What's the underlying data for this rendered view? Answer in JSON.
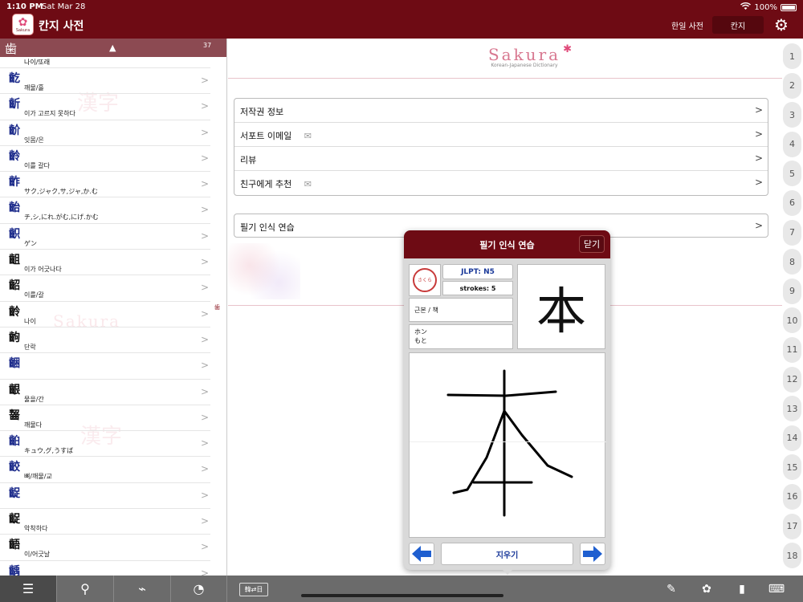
{
  "status": {
    "time": "1:10 PM",
    "date": "Sat Mar 28",
    "battery": "100%"
  },
  "header": {
    "app_icon_text": "Sakura",
    "title": "칸지 사전",
    "seg_left": "한일 사전",
    "seg_right": "칸지"
  },
  "left_list": {
    "header_kanji": "歯",
    "header_count": "37",
    "first_meaning": "나이/또래",
    "index_mark": "歯",
    "rows": [
      {
        "kanji": "齕",
        "meaning": "깨물/흘"
      },
      {
        "kanji": "齗",
        "meaning": "이가 고르지 못하다"
      },
      {
        "kanji": "齘",
        "meaning": "잇몸/은"
      },
      {
        "kanji": "齡",
        "meaning": "이를 갈다"
      },
      {
        "kanji": "齚",
        "meaning": "サク,ジャク,サ,ジャ,か.む"
      },
      {
        "kanji": "齝",
        "meaning": "チ,シ,にれ.がむ,にげ.かむ"
      },
      {
        "kanji": "齞",
        "meaning": "ゲン"
      },
      {
        "kanji": "齟",
        "meaning": "이가 어긋나다"
      },
      {
        "kanji": "齠",
        "meaning": "이를/갈"
      },
      {
        "kanji": "齡",
        "meaning": "나이"
      },
      {
        "kanji": "齣",
        "meaning": "단락"
      },
      {
        "kanji": "齫",
        "meaning": ""
      },
      {
        "kanji": "齦",
        "meaning": "물을/간"
      },
      {
        "kanji": "齧",
        "meaning": "깨물다"
      },
      {
        "kanji": "齨",
        "meaning": "キュウ,グ,うすば"
      },
      {
        "kanji": "齩",
        "meaning": "뼈/깨물/교"
      },
      {
        "kanji": "齪",
        "meaning": ""
      },
      {
        "kanji": "齪",
        "meaning": "악착하다"
      },
      {
        "kanji": "齬",
        "meaning": "이/어긋날"
      },
      {
        "kanji": "齲",
        "meaning": ""
      }
    ]
  },
  "watermarks": {
    "kanji1": "漢字",
    "sakura": "Sakura",
    "kanji2": "漢字"
  },
  "logo": {
    "word": "Sakura",
    "sub": "Korean-Japanese Dictionary"
  },
  "menu": {
    "items": [
      "저작권 정보",
      "서포트 이메일",
      "리뷰",
      "친구에게 추천"
    ],
    "practice": "필기 인식 연습"
  },
  "index_numbers": [
    "1",
    "2",
    "3",
    "4",
    "5",
    "6",
    "7",
    "8",
    "9",
    "10",
    "11",
    "12",
    "13",
    "14",
    "15",
    "16",
    "17",
    "18"
  ],
  "popover": {
    "title": "필기 인식 연습",
    "close": "닫기",
    "seal_text": "さくら",
    "jlpt": "JLPT: N5",
    "strokes": "strokes: 5",
    "meaning": "근본 / 책",
    "reading_on": "ホン",
    "reading_kun": "もと",
    "kanji": "本",
    "clear": "지우기"
  },
  "bottom": {
    "kb_label": "韓⇄日"
  }
}
